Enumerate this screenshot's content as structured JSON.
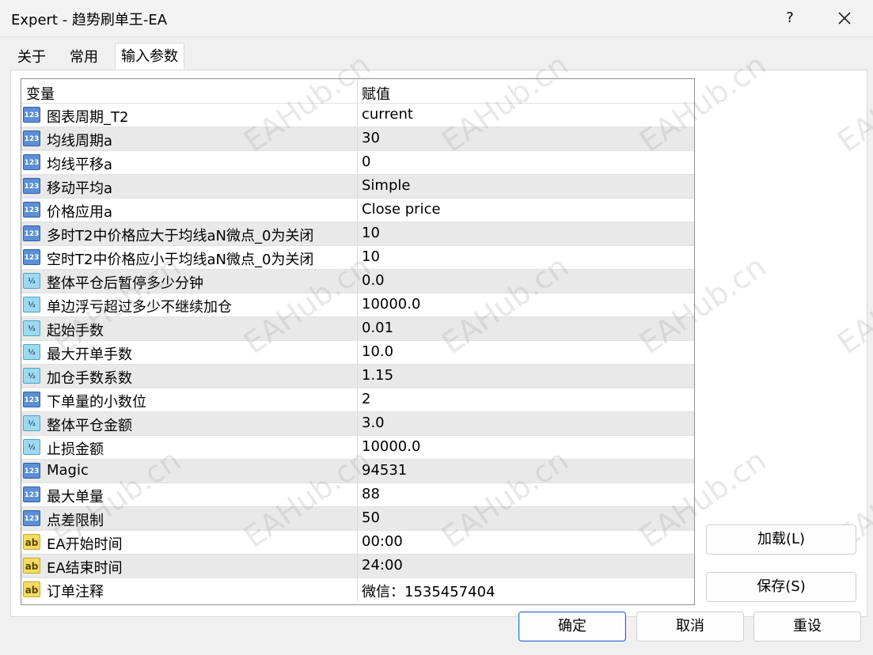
{
  "window": {
    "title": "Expert - 趋势刷单王-EA",
    "help_label": "?"
  },
  "tabs": [
    {
      "label": "关于"
    },
    {
      "label": "常用"
    },
    {
      "label": "输入参数"
    }
  ],
  "grid": {
    "headers": {
      "name": "变量",
      "value": "赋值"
    },
    "rows": [
      {
        "type": "int",
        "name": "图表周期_T2",
        "value": "current"
      },
      {
        "type": "int",
        "name": "均线周期a",
        "value": "30"
      },
      {
        "type": "int",
        "name": "均线平移a",
        "value": "0"
      },
      {
        "type": "int",
        "name": "移动平均a",
        "value": "Simple"
      },
      {
        "type": "int",
        "name": "价格应用a",
        "value": "Close price"
      },
      {
        "type": "int",
        "name": "多时T2中价格应大于均线aN微点_0为关闭",
        "value": "10"
      },
      {
        "type": "int",
        "name": "空时T2中价格应小于均线aN微点_0为关闭",
        "value": "10"
      },
      {
        "type": "dbl",
        "name": "整体平仓后暂停多少分钟",
        "value": "0.0"
      },
      {
        "type": "dbl",
        "name": "单边浮亏超过多少不继续加仓",
        "value": "10000.0"
      },
      {
        "type": "dbl",
        "name": "起始手数",
        "value": "0.01"
      },
      {
        "type": "dbl",
        "name": "最大开单手数",
        "value": "10.0"
      },
      {
        "type": "dbl",
        "name": "加仓手数系数",
        "value": "1.15"
      },
      {
        "type": "int",
        "name": "下单量的小数位",
        "value": "2"
      },
      {
        "type": "dbl",
        "name": "整体平仓金额",
        "value": "3.0"
      },
      {
        "type": "dbl",
        "name": "止损金额",
        "value": "10000.0"
      },
      {
        "type": "int",
        "name": "Magic",
        "value": "94531"
      },
      {
        "type": "int",
        "name": "最大单量",
        "value": "88"
      },
      {
        "type": "int",
        "name": "点差限制",
        "value": "50"
      },
      {
        "type": "str",
        "name": "EA开始时间",
        "value": "00:00"
      },
      {
        "type": "str",
        "name": "EA结束时间",
        "value": "24:00"
      },
      {
        "type": "str",
        "name": "订单注释",
        "value": "微信：1535457404"
      }
    ]
  },
  "icons": {
    "int": "123",
    "dbl": "½",
    "str": "ab"
  },
  "buttons": {
    "load": "加载(L)",
    "save": "保存(S)",
    "ok": "确定",
    "cancel": "取消",
    "reset": "重设"
  },
  "watermark": "EAHub.cn",
  "colors": {
    "accent": "#2a6fc9",
    "alt_row": "#e9e9e9"
  }
}
